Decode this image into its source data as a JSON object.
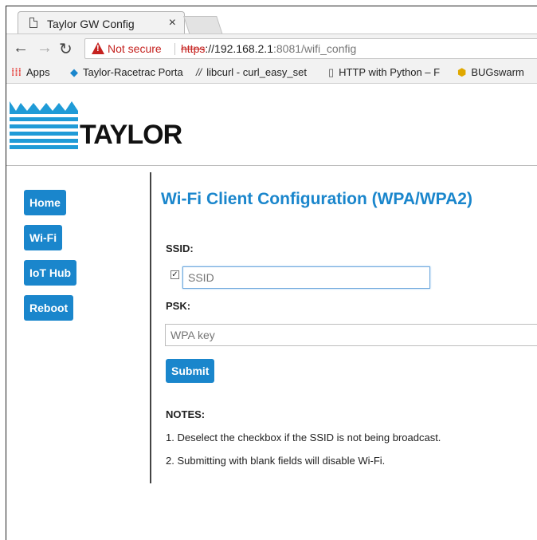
{
  "browser": {
    "tab_title": "Taylor GW Config",
    "tab_close": "×",
    "security_label": "Not secure",
    "url_scheme": "https",
    "url_host": "://192.168.2.1",
    "url_path": ":8081/wifi_config",
    "bookmarks": [
      {
        "label": "Apps",
        "icon": "apps-icon"
      },
      {
        "label": "Taylor-Racetrac Porta",
        "icon": "diamond-icon"
      },
      {
        "label": "libcurl - curl_easy_set",
        "icon": "slashes-icon"
      },
      {
        "label": "HTTP with Python – F",
        "icon": "page-icon"
      },
      {
        "label": "BUGswarm",
        "icon": "bees-icon"
      }
    ]
  },
  "logo": {
    "text": "TAYLOR"
  },
  "nav": {
    "home": "Home",
    "wifi": "Wi-Fi",
    "iot_hub": "IoT Hub",
    "reboot": "Reboot"
  },
  "main": {
    "heading": "Wi-Fi Client Configuration (WPA/WPA2)",
    "ssid_label": "SSID:",
    "ssid_checked": true,
    "ssid_placeholder": "SSID",
    "psk_label": "PSK:",
    "psk_placeholder": "WPA key",
    "submit_label": "Submit",
    "notes_title": "NOTES:",
    "notes": [
      "1. Deselect the checkbox if the SSID is not being broadcast.",
      "2. Submitting with blank fields will disable Wi-Fi."
    ]
  },
  "colors": {
    "accent": "#1a86cc",
    "warning": "#c5221f",
    "logo_blue": "#1f9bd7"
  }
}
